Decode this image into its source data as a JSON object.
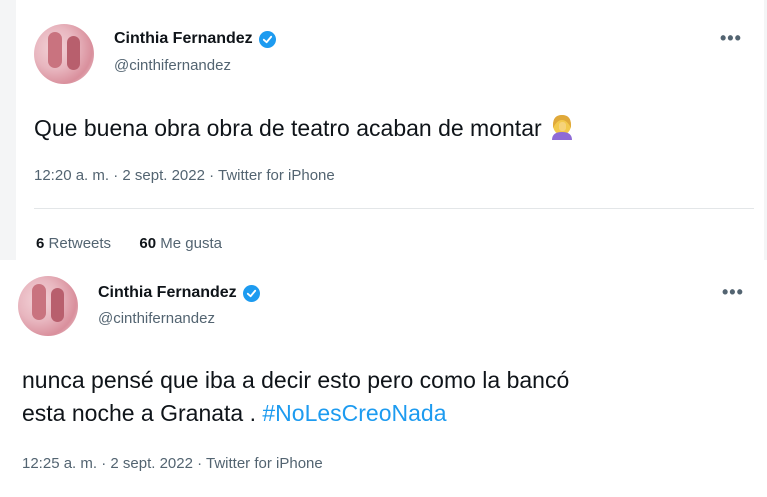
{
  "tweets": [
    {
      "author_name": "Cinthia Fernandez",
      "handle": "@cinthifernandez",
      "text": "Que buena obra obra de teatro acaban de montar",
      "emoji": "facepalm-woman-emoji",
      "timestamp": "12:20 a. m. · 2 sept. 2022 · Twitter for iPhone",
      "retweets_count": "6",
      "retweets_label": "Retweets",
      "likes_count": "60",
      "likes_label": "Me gusta",
      "more_label": "•••"
    },
    {
      "author_name": "Cinthia Fernandez",
      "handle": "@cinthifernandez",
      "text_line1": "nunca pensé que iba a decir esto pero como la bancó",
      "text_line2": "esta noche a Granata .",
      "hashtag": "#NoLesCreoNada",
      "timestamp": "12:25 a. m. · 2 sept. 2022 · Twitter for iPhone",
      "more_label": "•••"
    }
  ],
  "colors": {
    "verified": "#1d9bf0",
    "hashtag": "#1d9bf0",
    "secondary_text": "#536471"
  }
}
